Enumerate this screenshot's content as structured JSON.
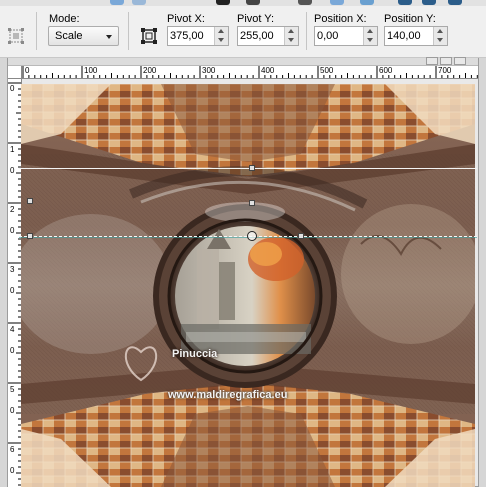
{
  "toolbar": {
    "mode_label": "Mode:",
    "mode_value": "Scale",
    "pivot_x_label": "Pivot X:",
    "pivot_x_value": "375,00",
    "pivot_y_label": "Pivot Y:",
    "pivot_y_value": "255,00",
    "position_x_label": "Position X:",
    "position_x_value": "0,00",
    "position_y_label": "Position Y:",
    "position_y_value": "140,00"
  },
  "ruler_top": [
    "0",
    "100",
    "200",
    "300",
    "400",
    "500",
    "600",
    "700"
  ],
  "ruler_left": [
    "0",
    "1",
    "0",
    "2",
    "0",
    "3",
    "0",
    "4",
    "0",
    "5",
    "0",
    "6",
    "0"
  ],
  "watermark": {
    "name": "Pinuccia",
    "url": "www.maldiregrafica.eu"
  },
  "colors": {
    "guide_line": "#ffffff",
    "selection_line": "#3aa0a0",
    "warm_orange": "#d07a2a",
    "dark_brown": "#4a2e22"
  }
}
